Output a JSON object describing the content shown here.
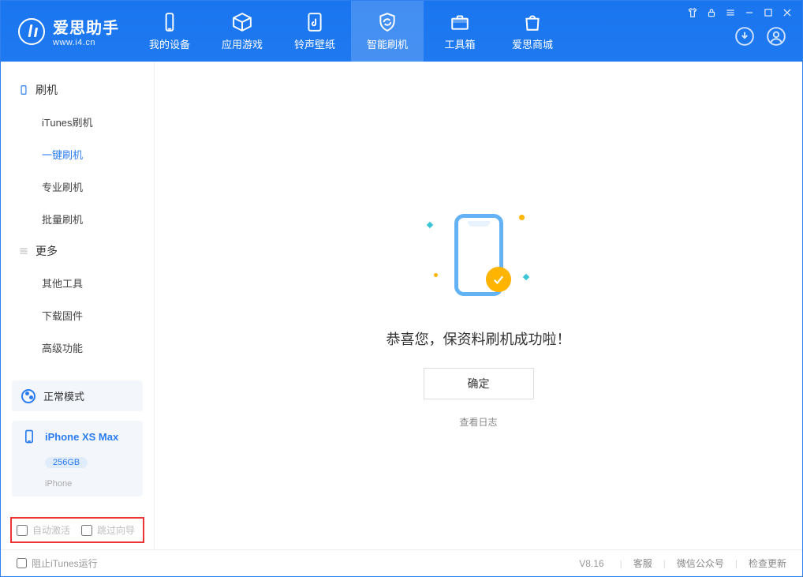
{
  "app": {
    "title": "爱思助手",
    "subtitle": "www.i4.cn"
  },
  "nav": {
    "items": [
      {
        "label": "我的设备"
      },
      {
        "label": "应用游戏"
      },
      {
        "label": "铃声壁纸"
      },
      {
        "label": "智能刷机"
      },
      {
        "label": "工具箱"
      },
      {
        "label": "爱思商城"
      }
    ]
  },
  "sidebar": {
    "section_flash_title": "刷机",
    "section_more_title": "更多",
    "flash_items": [
      {
        "label": "iTunes刷机"
      },
      {
        "label": "一键刷机"
      },
      {
        "label": "专业刷机"
      },
      {
        "label": "批量刷机"
      }
    ],
    "more_items": [
      {
        "label": "其他工具"
      },
      {
        "label": "下载固件"
      },
      {
        "label": "高级功能"
      }
    ],
    "mode_label": "正常模式",
    "device": {
      "name": "iPhone XS Max",
      "capacity": "256GB",
      "type": "iPhone"
    },
    "opts": {
      "auto_activate_label": "自动激活",
      "skip_guide_label": "跳过向导"
    }
  },
  "main": {
    "success_message": "恭喜您，保资料刷机成功啦！",
    "ok_label": "确定",
    "view_log_label": "查看日志"
  },
  "footer": {
    "block_itunes_label": "阻止iTunes运行",
    "version": "V8.16",
    "links": {
      "support": "客服",
      "wechat": "微信公众号",
      "check_update": "检查更新"
    }
  }
}
